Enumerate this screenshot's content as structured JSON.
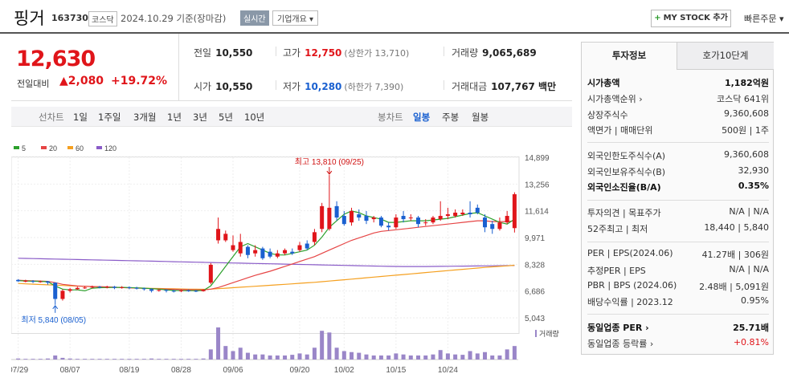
{
  "header": {
    "name": "핑거",
    "code": "163730",
    "market": "코스닥",
    "date_info": "2024.10.29 기준(장마감)",
    "realtime": "실시간",
    "corp_overview": "기업개요",
    "mystock": "MY STOCK 추가",
    "quick_order": "빠른주문"
  },
  "price": {
    "current": "12,630",
    "change_label": "전일대비",
    "change_value": "▲2,080",
    "change_pct": "+19.72%"
  },
  "summary": {
    "prev": {
      "label": "전일",
      "value": "10,550"
    },
    "high": {
      "label": "고가",
      "value": "12,750",
      "sub": "(상한가 13,710)"
    },
    "volume": {
      "label": "거래량",
      "value": "9,065,689"
    },
    "open": {
      "label": "시가",
      "value": "10,550"
    },
    "low": {
      "label": "저가",
      "value": "10,280",
      "sub": "(하한가 7,390)"
    },
    "amount": {
      "label": "거래대금",
      "value": "107,767 백만"
    }
  },
  "periods": {
    "label": "선차트",
    "items": [
      "1일",
      "1주일",
      "3개월",
      "1년",
      "3년",
      "5년",
      "10년"
    ],
    "candle_label": "봉차트",
    "candle_items": [
      "일봉",
      "주봉",
      "월봉"
    ],
    "candle_selected": "일봉"
  },
  "chart_data": {
    "type": "candlestick",
    "legend": [
      {
        "name": "5",
        "color": "#2ca02c"
      },
      {
        "name": "20",
        "color": "#e64545"
      },
      {
        "name": "60",
        "color": "#f5a020"
      },
      {
        "name": "120",
        "color": "#8a5cc8"
      }
    ],
    "y_ticks": [
      "14,899",
      "13,256",
      "11,614",
      "9,971",
      "8,328",
      "6,686",
      "5,043"
    ],
    "x_ticks": [
      "07/29",
      "08/07",
      "08/19",
      "08/28",
      "09/06",
      "09/20",
      "10/02",
      "10/15",
      "10/24"
    ],
    "high_label": "최고 13,810 (09/25)",
    "low_label": "최저 5,840 (08/05)",
    "volume_label": "거래량",
    "ylim": [
      5043,
      14899
    ],
    "candles": [
      [
        7370,
        7290,
        7420,
        7250
      ],
      [
        7290,
        7310,
        7380,
        7220
      ],
      [
        7300,
        7250,
        7360,
        7180
      ],
      [
        7250,
        7280,
        7330,
        7200
      ],
      [
        7280,
        7200,
        7310,
        7080
      ],
      [
        7200,
        6200,
        7220,
        5840
      ],
      [
        6200,
        6700,
        6800,
        6100
      ],
      [
        6700,
        6800,
        6880,
        6600
      ],
      [
        6800,
        6880,
        6950,
        6750
      ],
      [
        6880,
        6900,
        6980,
        6820
      ],
      [
        6900,
        6950,
        7020,
        6850
      ],
      [
        6950,
        6900,
        7000,
        6850
      ],
      [
        6900,
        6950,
        7010,
        6850
      ],
      [
        6950,
        6880,
        7000,
        6800
      ],
      [
        6880,
        6920,
        6990,
        6830
      ],
      [
        6920,
        6880,
        6970,
        6800
      ],
      [
        6880,
        6850,
        6950,
        6780
      ],
      [
        6850,
        6800,
        6900,
        6720
      ],
      [
        6800,
        6700,
        6850,
        6600
      ],
      [
        6700,
        6750,
        6800,
        6650
      ],
      [
        6750,
        6700,
        6800,
        6600
      ],
      [
        6700,
        6680,
        6760,
        6600
      ],
      [
        6680,
        6720,
        6780,
        6620
      ],
      [
        6720,
        6700,
        6780,
        6640
      ],
      [
        6700,
        6680,
        6760,
        6620
      ],
      [
        6680,
        6760,
        6800,
        6650
      ],
      [
        7200,
        8300,
        8400,
        7100
      ],
      [
        9800,
        10500,
        11200,
        9600
      ],
      [
        9800,
        10200,
        10400,
        9700
      ],
      [
        9200,
        9500,
        10100,
        9100
      ],
      [
        9000,
        9700,
        10200,
        8800
      ],
      [
        9400,
        8900,
        9500,
        8700
      ],
      [
        9000,
        9200,
        9500,
        8800
      ],
      [
        9300,
        8700,
        9400,
        8600
      ],
      [
        9100,
        8800,
        9300,
        8700
      ],
      [
        8800,
        9000,
        9200,
        8700
      ],
      [
        9000,
        9200,
        9300,
        8900
      ],
      [
        9100,
        9000,
        9300,
        8900
      ],
      [
        9200,
        9500,
        9700,
        9100
      ],
      [
        9600,
        9300,
        9800,
        9200
      ],
      [
        9700,
        10300,
        10500,
        9500
      ],
      [
        10500,
        11900,
        12100,
        10300
      ],
      [
        10500,
        11800,
        13810,
        10400
      ],
      [
        11900,
        11200,
        12200,
        11000
      ],
      [
        11300,
        10800,
        11600,
        10700
      ],
      [
        10900,
        11600,
        11800,
        10700
      ],
      [
        11400,
        11200,
        11700,
        11000
      ],
      [
        11300,
        11000,
        11600,
        10800
      ],
      [
        11100,
        11200,
        11300,
        10900
      ],
      [
        11200,
        10700,
        11300,
        10600
      ],
      [
        10700,
        10600,
        10900,
        10400
      ],
      [
        10600,
        11200,
        11400,
        10500
      ],
      [
        11300,
        11100,
        11600,
        10900
      ],
      [
        11200,
        11200,
        11400,
        11000
      ],
      [
        11200,
        10800,
        11300,
        10600
      ],
      [
        10900,
        10900,
        11100,
        10700
      ],
      [
        10900,
        11200,
        11300,
        10800
      ],
      [
        11100,
        11300,
        12200,
        11000
      ],
      [
        11300,
        11400,
        11800,
        11100
      ],
      [
        11300,
        11500,
        11700,
        11200
      ],
      [
        11400,
        11500,
        11700,
        11300
      ],
      [
        11500,
        11400,
        12200,
        11200
      ],
      [
        11800,
        11500,
        12000,
        11400
      ],
      [
        11200,
        10600,
        11400,
        10300
      ],
      [
        10800,
        10500,
        11000,
        10200
      ],
      [
        10500,
        10900,
        11200,
        10400
      ],
      [
        10900,
        11300,
        11600,
        10800
      ],
      [
        10550,
        12630,
        12750,
        10280
      ]
    ],
    "volumes": [
      3,
      2,
      2,
      2,
      3,
      12,
      5,
      3,
      2,
      2,
      2,
      2,
      2,
      2,
      2,
      2,
      2,
      2,
      3,
      2,
      2,
      2,
      2,
      2,
      2,
      3,
      30,
      95,
      40,
      25,
      35,
      20,
      15,
      15,
      12,
      12,
      12,
      14,
      18,
      15,
      35,
      85,
      80,
      35,
      25,
      22,
      20,
      15,
      12,
      12,
      12,
      18,
      15,
      12,
      12,
      12,
      15,
      28,
      18,
      15,
      14,
      25,
      18,
      22,
      12,
      12,
      30,
      40
    ],
    "ma5": [
      7330,
      7300,
      7290,
      7280,
      7260,
      7000,
      6800,
      6760,
      6760,
      6700,
      6860,
      6890,
      6900,
      6910,
      6910,
      6900,
      6880,
      6860,
      6830,
      6800,
      6760,
      6730,
      6710,
      6710,
      6710,
      6720,
      7000,
      7600,
      8200,
      8800,
      9400,
      9600,
      9400,
      9200,
      9000,
      8900,
      8900,
      9000,
      9100,
      9200,
      9500,
      10000,
      10600,
      11000,
      11400,
      11600,
      11500,
      11300,
      11200,
      11100,
      10900,
      10900,
      10950,
      11000,
      11000,
      11000,
      11050,
      11100,
      11150,
      11250,
      11350,
      11450,
      11500,
      11300,
      11100,
      10900,
      10800,
      11100
    ],
    "ma20": [
      7350,
      7330,
      7310,
      7300,
      7280,
      7200,
      7100,
      7050,
      7000,
      6980,
      6960,
      6950,
      6940,
      6920,
      6900,
      6880,
      6870,
      6850,
      6830,
      6810,
      6800,
      6790,
      6780,
      6770,
      6760,
      6760,
      6800,
      6900,
      7050,
      7200,
      7350,
      7500,
      7650,
      7780,
      7900,
      8050,
      8200,
      8350,
      8500,
      8650,
      8800,
      9000,
      9200,
      9400,
      9600,
      9800,
      9950,
      10100,
      10250,
      10350,
      10400,
      10450,
      10500,
      10550,
      10600,
      10650,
      10700,
      10750,
      10800,
      10850,
      10900,
      10950,
      11000,
      11000,
      10950,
      10950,
      10950,
      11000
    ],
    "ma60": [
      7150,
      7130,
      7110,
      7090,
      7070,
      7050,
      7030,
      7010,
      6990,
      6975,
      6960,
      6945,
      6930,
      6915,
      6900,
      6885,
      6870,
      6860,
      6850,
      6840,
      6830,
      6820,
      6810,
      6800,
      6795,
      6790,
      6800,
      6830,
      6860,
      6890,
      6920,
      6950,
      6980,
      7010,
      7040,
      7070,
      7100,
      7130,
      7160,
      7190,
      7220,
      7260,
      7300,
      7340,
      7380,
      7420,
      7460,
      7500,
      7540,
      7580,
      7620,
      7660,
      7700,
      7740,
      7780,
      7820,
      7860,
      7900,
      7940,
      7980,
      8020,
      8060,
      8100,
      8140,
      8170,
      8200,
      8230,
      8270
    ],
    "ma120": [
      8700,
      8690,
      8680,
      8670,
      8660,
      8650,
      8640,
      8630,
      8620,
      8610,
      8600,
      8590,
      8580,
      8570,
      8560,
      8550,
      8540,
      8530,
      8520,
      8510,
      8500,
      8490,
      8480,
      8470,
      8460,
      8450,
      8440,
      8430,
      8420,
      8410,
      8400,
      8390,
      8380,
      8370,
      8360,
      8350,
      8340,
      8330,
      8320,
      8310,
      8300,
      8290,
      8280,
      8270,
      8260,
      8250,
      8240,
      8230,
      8220,
      8210,
      8200,
      8195,
      8190,
      8190,
      8190,
      8190,
      8195,
      8200,
      8205,
      8210,
      8215,
      8220,
      8225,
      8230,
      8235,
      8240,
      8245,
      8250
    ]
  },
  "side": {
    "tab1": "투자정보",
    "tab2": "호가10단계",
    "rows": [
      {
        "l": "시가총액",
        "r": "1,182억원",
        "bold": true
      },
      {
        "l": "시가총액순위 ›",
        "r": "코스닥 641위"
      },
      {
        "l": "상장주식수",
        "r": "9,360,608"
      },
      {
        "l": "액면가 | 매매단위",
        "r": "500원 | 1주"
      },
      {
        "l": "외국인한도주식수(A)",
        "r": "9,360,608"
      },
      {
        "l": "외국인보유주식수(B)",
        "r": "32,930"
      },
      {
        "l": "외국인소진율(B/A)",
        "r": "0.35%",
        "bold": true
      },
      {
        "l": "투자의견 | 목표주가",
        "r": "N/A | N/A"
      },
      {
        "l": "52주최고 | 최저",
        "r": "18,440 | 5,840"
      },
      {
        "l": "PER | EPS(2024.06)",
        "r": "41.27배 | 306원"
      },
      {
        "l": "추정PER | EPS",
        "r": "N/A | N/A"
      },
      {
        "l": "PBR | BPS (2024.06)",
        "r": "2.48배 | 5,091원"
      },
      {
        "l": "배당수익률 | 2023.12",
        "r": "0.95%"
      },
      {
        "l": "동일업종 PER ›",
        "r": "25.71배",
        "bold": true
      },
      {
        "l": "동일업종 등락률 ›",
        "r": "+0.81%",
        "up": true
      }
    ]
  }
}
